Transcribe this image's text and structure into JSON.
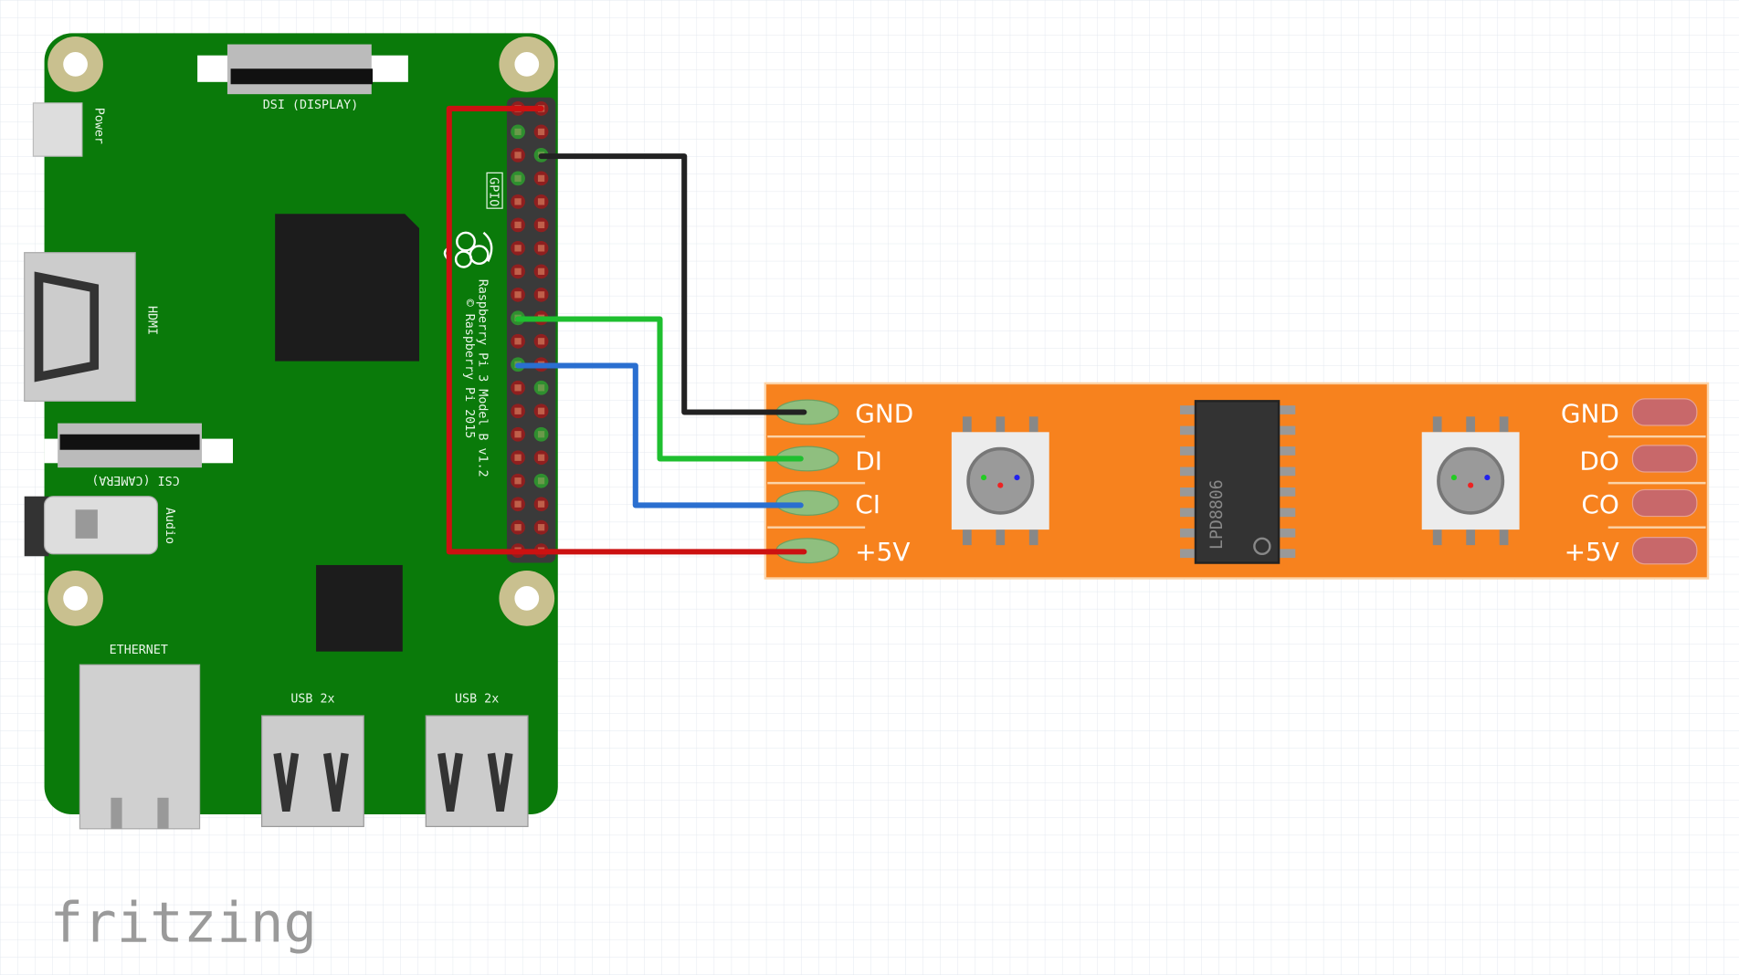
{
  "board": {
    "name": "Raspberry Pi 3 Model B v1.2",
    "copyright": "© Raspberry Pi 2015",
    "labels": {
      "dsi": "DSI (DISPLAY)",
      "power": "Power",
      "hdmi": "HDMI",
      "csi": "CSI (CAMERA)",
      "audio": "Audio",
      "gpio": "GPIO",
      "ethernet": "ETHERNET",
      "usb1": "USB 2x",
      "usb2": "USB 2x"
    },
    "color": "#0a7a0a"
  },
  "strip": {
    "color": "#f7821e",
    "chip_label": "LPD8806",
    "left_pins": [
      "GND",
      "DI",
      "CI",
      "+5V"
    ],
    "right_pins": [
      "GND",
      "DO",
      "CO",
      "+5V"
    ]
  },
  "wires": [
    {
      "name": "5v",
      "color": "#cc1111",
      "to": "+5V"
    },
    {
      "name": "gnd",
      "color": "#222222",
      "to": "GND"
    },
    {
      "name": "data",
      "color": "#1fbf2f",
      "to": "DI"
    },
    {
      "name": "clock",
      "color": "#2a6fd0",
      "to": "CI"
    }
  ],
  "watermark": "fritzing"
}
